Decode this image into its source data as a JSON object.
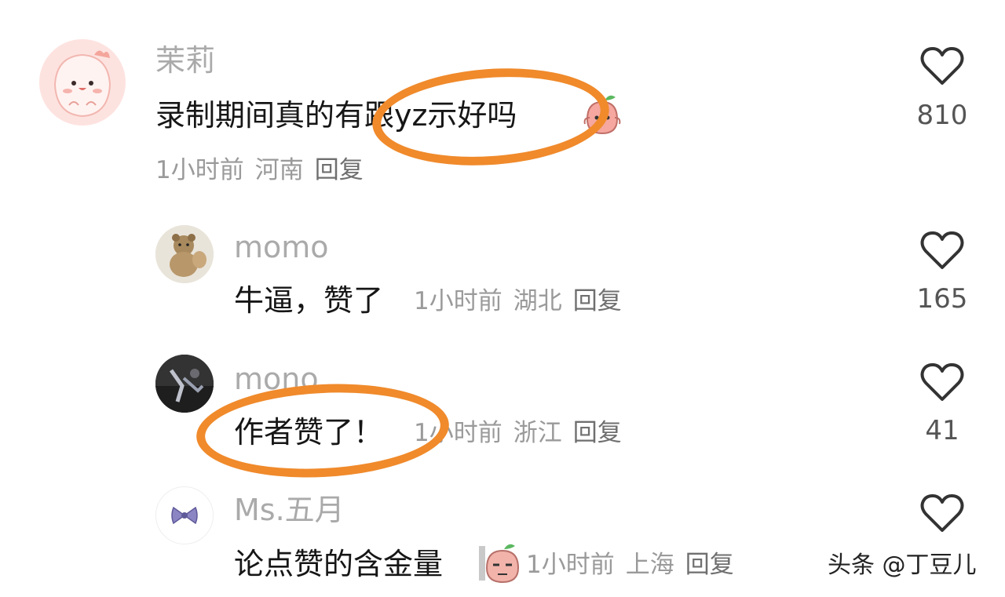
{
  "comments": [
    {
      "username": "茉莉",
      "text": "录制期间真的有跟yz示好吗",
      "time": "1小时前",
      "location": "河南",
      "reply_label": "回复",
      "likes": "810",
      "avatar_icon": "pink-blob-avatar"
    },
    {
      "username": "momo",
      "text": "牛逼，赞了",
      "time": "1小时前",
      "location": "湖北",
      "reply_label": "回复",
      "likes": "165",
      "avatar_icon": "plush-toy-avatar"
    },
    {
      "username": "mono",
      "text": "作者赞了！",
      "time": "1小时前",
      "location": "浙江",
      "reply_label": "回复",
      "likes": "41",
      "avatar_icon": "dark-photo-avatar"
    },
    {
      "username": "Ms.五月",
      "text": "论点赞的含金量",
      "time": "1小时前",
      "location": "上海",
      "reply_label": "回复",
      "likes": "",
      "avatar_icon": "bow-avatar"
    }
  ],
  "watermark": "头条 @丁豆儿",
  "colors": {
    "highlight": "#f08a2b",
    "username": "#aaaaaa",
    "meta": "#9a9a9a"
  }
}
